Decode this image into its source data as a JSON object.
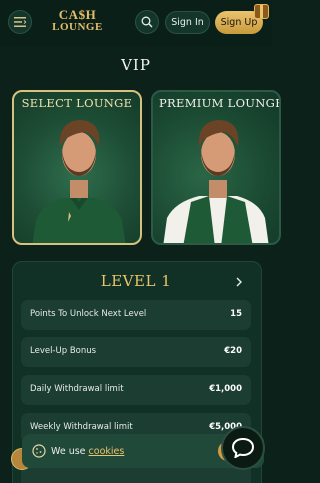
{
  "brand": {
    "logo_line1": "CA$H",
    "logo_line2": "LOUNGE"
  },
  "header": {
    "sign_in_label": "Sign In",
    "sign_up_label": "Sign Up"
  },
  "page": {
    "title": "VIP"
  },
  "lounges": [
    {
      "title": "SELECT LOUNGE",
      "shirt_color": "#1f5a36"
    },
    {
      "title": "PREMIUM LOUNGE",
      "shirt_color": "#f2f0ea"
    }
  ],
  "level": {
    "title": "LEVEL 1",
    "rows": [
      {
        "label": "Points To Unlock Next Level",
        "value": "15"
      },
      {
        "label": "Level-Up Bonus",
        "value": "€20"
      },
      {
        "label": "Daily Withdrawal limit",
        "value": "€1,000"
      },
      {
        "label": "Weekly Withdrawal limit",
        "value": "€5,000"
      }
    ]
  },
  "cookie_banner": {
    "text": "We use",
    "link_label": "cookies"
  },
  "colors": {
    "accent_gold": "#e9c46a",
    "background": "#0b2119",
    "panel": "#113126",
    "row": "#1c3d31"
  },
  "icons": [
    "menu-icon",
    "search-icon",
    "gift-icon",
    "chevron-right-icon",
    "cookie-icon",
    "chat-icon"
  ]
}
